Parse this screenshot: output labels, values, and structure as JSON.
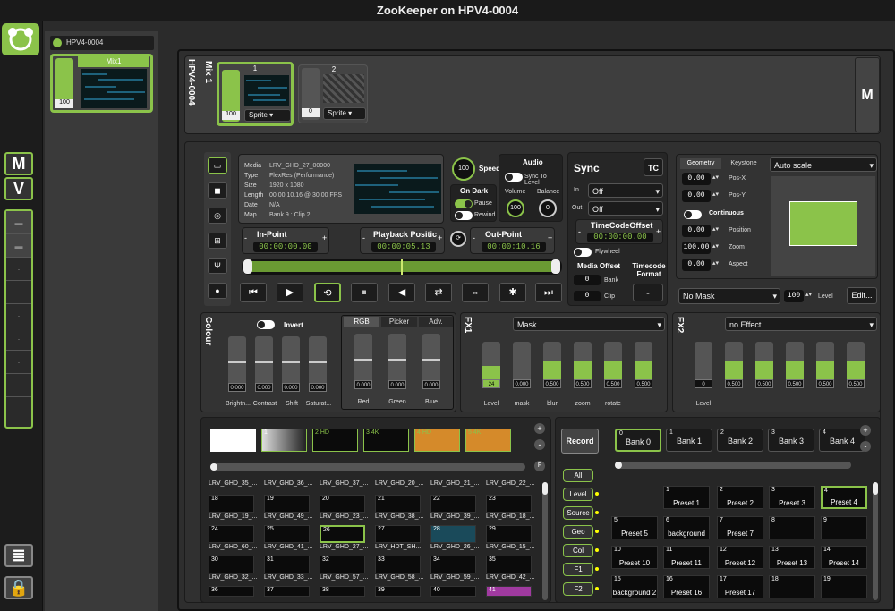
{
  "window": {
    "title": "ZooKeeper on HPV4-0004"
  },
  "sidebar": {
    "m_label": "M",
    "v_label": "V"
  },
  "server": {
    "name": "HPV4-0004",
    "mix_label": "Mix1",
    "mix_level": "100"
  },
  "mix": {
    "label": "Mix 1",
    "server": "HPV4-0004",
    "m_button": "M",
    "layers": [
      {
        "num": "1",
        "level": "100",
        "type": "Sprite"
      },
      {
        "num": "2",
        "level": "0",
        "type": "Sprite"
      }
    ]
  },
  "media": {
    "fields": [
      {
        "k": "Media",
        "v": "LRV_GHD_27_00000"
      },
      {
        "k": "Type",
        "v": "FlexRes (Performance)"
      },
      {
        "k": "Size",
        "v": "1920 x 1080"
      },
      {
        "k": "Length",
        "v": "00:00:10.16 @ 30.00 FPS"
      },
      {
        "k": "Date",
        "v": "N/A"
      },
      {
        "k": "Map",
        "v": "Bank 9 : Clip 2"
      }
    ],
    "speed_label": "Speed",
    "speed_value": "100",
    "on_dark": "On Dark",
    "pause": "Pause",
    "rewind": "Rewind",
    "audio": "Audio",
    "sync_to_level": "Sync To Level",
    "volume": "Volume",
    "balance": "Balance",
    "volume_value": "100",
    "balance_value": "0",
    "in_point": "In-Point",
    "in_value": "00:00:00.00",
    "playback": "Playback Positic",
    "playback_value": "00:00:05.13",
    "out_point": "Out-Point",
    "out_value": "00:00:10.16"
  },
  "sync": {
    "title": "Sync",
    "tc": "TC",
    "in_label": "In",
    "in_value": "Off",
    "out_label": "Out",
    "out_value": "Off",
    "tco_label": "TimeCodeOffset",
    "tco_value": "00:00:00.00",
    "flywheel": "Flywheel",
    "media_offset": "Media Offset",
    "timecode_format": "Timecode Format",
    "bank_label": "Bank",
    "bank_value": "0",
    "clip_label": "Clip",
    "clip_value": "0",
    "tf_value": "-"
  },
  "geometry": {
    "tabs": [
      "Geometry",
      "Keystone"
    ],
    "scale": "Auto scale",
    "fields": [
      {
        "v": "0.00",
        "k": "Pos-X"
      },
      {
        "v": "0.00",
        "k": "Pos-Y"
      }
    ],
    "continuous": "Continuous",
    "fields2": [
      {
        "v": "0.00",
        "k": "Position"
      },
      {
        "v": "100.00",
        "k": "Zoom"
      },
      {
        "v": "0.00",
        "k": "Aspect"
      }
    ],
    "mask": "No Mask",
    "mask_level": "100",
    "level_label": "Level",
    "edit": "Edit..."
  },
  "colour": {
    "title": "Colour",
    "invert": "Invert",
    "tabs": [
      "RGB",
      "Picker",
      "Adv."
    ],
    "sliders": [
      {
        "label": "Brightn...",
        "value": "0.000"
      },
      {
        "label": "Contrast",
        "value": "0.000"
      },
      {
        "label": "Shift",
        "value": "0.000"
      },
      {
        "label": "Saturat...",
        "value": "0.000"
      }
    ],
    "rgb": [
      {
        "label": "Red",
        "value": "0.000"
      },
      {
        "label": "Green",
        "value": "0.000"
      },
      {
        "label": "Blue",
        "value": "0.000"
      }
    ]
  },
  "fx1": {
    "title": "FX1",
    "effect": "Mask",
    "sliders": [
      {
        "label": "Level",
        "value": "24",
        "fill": 0.35
      },
      {
        "label": "mask",
        "value": "0.000",
        "fill": 0
      },
      {
        "label": "blur",
        "value": "0.500",
        "fill": 0.5
      },
      {
        "label": "zoom",
        "value": "0.500",
        "fill": 0.5
      },
      {
        "label": "rotate",
        "value": "0.500",
        "fill": 0.5
      },
      {
        "label": "",
        "value": "0.500",
        "fill": 0.5
      }
    ]
  },
  "fx2": {
    "title": "FX2",
    "effect": "no Effect",
    "sliders": [
      {
        "label": "Level",
        "value": "0",
        "fill": 0
      },
      {
        "label": "",
        "value": "0.500",
        "fill": 0.5
      },
      {
        "label": "",
        "value": "0.500",
        "fill": 0.5
      },
      {
        "label": "",
        "value": "0.500",
        "fill": 0.5
      },
      {
        "label": "",
        "value": "0.500",
        "fill": 0.5
      },
      {
        "label": "",
        "value": "0.500",
        "fill": 0.5
      }
    ]
  },
  "media_bins": [
    "",
    "1",
    "2 HD",
    "3 4K",
    "4 HD",
    "5 4K"
  ],
  "clips": [
    [
      "LRV_GHD_35_...",
      "LRV_GHD_36_...",
      "LRV_GHD_37_...",
      "LRV_GHD_20_...",
      "LRV_GHD_21_...",
      "LRV_GHD_22_..."
    ],
    [
      {
        "n": "18",
        "l": "LRV_GHD_19_..."
      },
      {
        "n": "19",
        "l": "LRV_GHD_49_..."
      },
      {
        "n": "20",
        "l": "LRV_GHD_23_..."
      },
      {
        "n": "21",
        "l": "LRV_GHD_38_..."
      },
      {
        "n": "22",
        "l": "LRV_GHD_39_..."
      },
      {
        "n": "23",
        "l": "LRV_GHD_18_..."
      }
    ],
    [
      {
        "n": "24",
        "l": "LRV_GHD_60_..."
      },
      {
        "n": "25",
        "l": "LRV_GHD_41_..."
      },
      {
        "n": "26",
        "l": "LRV_GHD_27_..."
      },
      {
        "n": "27",
        "l": "LRV_HDT_SH..."
      },
      {
        "n": "28",
        "l": "LRV_GHD_26_..."
      },
      {
        "n": "29",
        "l": "LRV_GHD_15_..."
      }
    ],
    [
      {
        "n": "30",
        "l": "LRV_GHD_32_..."
      },
      {
        "n": "31",
        "l": "LRV_GHD_33_..."
      },
      {
        "n": "32",
        "l": "LRV_GHD_57_..."
      },
      {
        "n": "33",
        "l": "LRV_GHD_58_..."
      },
      {
        "n": "34",
        "l": "LRV_GHD_59_..."
      },
      {
        "n": "35",
        "l": "LRV_GHD_42_..."
      }
    ],
    [
      {
        "n": "36",
        "l": ""
      },
      {
        "n": "37",
        "l": ""
      },
      {
        "n": "38",
        "l": ""
      },
      {
        "n": "39",
        "l": ""
      },
      {
        "n": "40",
        "l": ""
      },
      {
        "n": "41",
        "l": ""
      }
    ]
  ],
  "record": {
    "label": "Record",
    "pills": [
      "All",
      "Level",
      "Source",
      "Geo",
      "Col",
      "F1",
      "F2"
    ]
  },
  "banks": [
    {
      "n": "0",
      "l": "Bank 0"
    },
    {
      "n": "1",
      "l": "Bank 1"
    },
    {
      "n": "2",
      "l": "Bank 2"
    },
    {
      "n": "3",
      "l": "Bank 3"
    },
    {
      "n": "4",
      "l": "Bank 4"
    }
  ],
  "presets": [
    {
      "n": "1",
      "l": "Preset 1"
    },
    {
      "n": "2",
      "l": "Preset 2"
    },
    {
      "n": "3",
      "l": "Preset 3"
    },
    {
      "n": "4",
      "l": "Preset 4"
    },
    {
      "n": "5",
      "l": "Preset 5"
    },
    {
      "n": "6",
      "l": "background"
    },
    {
      "n": "7",
      "l": "Preset 7"
    },
    {
      "n": "8",
      "l": ""
    },
    {
      "n": "9",
      "l": ""
    },
    {
      "n": "10",
      "l": "Preset 10"
    },
    {
      "n": "11",
      "l": "Preset 11"
    },
    {
      "n": "12",
      "l": "Preset 12"
    },
    {
      "n": "13",
      "l": "Preset 13"
    },
    {
      "n": "14",
      "l": "Preset 14"
    },
    {
      "n": "15",
      "l": "background 2"
    },
    {
      "n": "16",
      "l": "Preset 16"
    },
    {
      "n": "17",
      "l": "Preset 17"
    },
    {
      "n": "18",
      "l": ""
    },
    {
      "n": "19",
      "l": ""
    }
  ],
  "transport": [
    "⏮",
    "▶",
    "⟲",
    "⏸",
    "◀",
    "⇄",
    "⇔",
    "✱",
    "⏭"
  ],
  "accent": "#8bc34a"
}
